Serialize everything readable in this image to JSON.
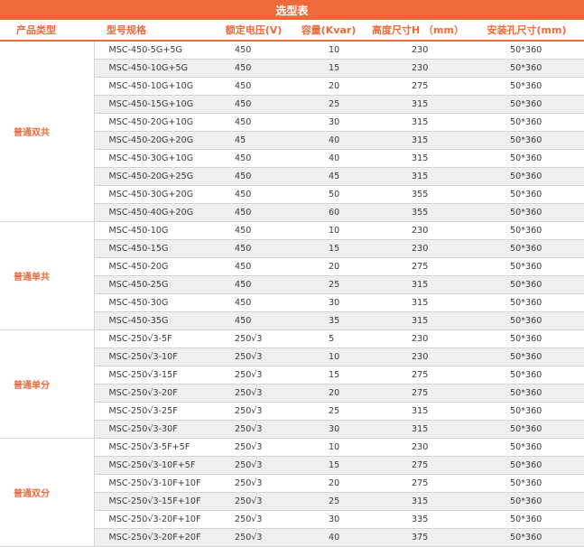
{
  "title": "选型表",
  "headers": [
    "产品类型",
    "型号规格",
    "额定电压(V)",
    "容量(Kvar)",
    "高度尺寸H （mm）",
    "安装孔尺寸(mm)"
  ],
  "groups": [
    {
      "type": "普通双共",
      "rows": [
        [
          "MSC-450-5G+5G",
          "450",
          "10",
          "230",
          "50*360"
        ],
        [
          "MSC-450-10G+5G",
          "450",
          "15",
          "230",
          "50*360"
        ],
        [
          "MSC-450-10G+10G",
          "450",
          "20",
          "275",
          "50*360"
        ],
        [
          "MSC-450-15G+10G",
          "450",
          "25",
          "315",
          "50*360"
        ],
        [
          "MSC-450-20G+10G",
          "450",
          "30",
          "315",
          "50*360"
        ],
        [
          "MSC-450-20G+20G",
          "45",
          "40",
          "315",
          "50*360"
        ],
        [
          "MSC-450-30G+10G",
          "450",
          "40",
          "315",
          "50*360"
        ],
        [
          "MSC-450-20G+25G",
          "450",
          "45",
          "315",
          "50*360"
        ],
        [
          "MSC-450-30G+20G",
          "450",
          "50",
          "355",
          "50*360"
        ],
        [
          "MSC-450-40G+20G",
          "450",
          "60",
          "355",
          "50*360"
        ]
      ]
    },
    {
      "type": "普通单共",
      "rows": [
        [
          "MSC-450-10G",
          "450",
          "10",
          "230",
          "50*360"
        ],
        [
          "MSC-450-15G",
          "450",
          "15",
          "230",
          "50*360"
        ],
        [
          "MSC-450-20G",
          "450",
          "20",
          "275",
          "50*360"
        ],
        [
          "MSC-450-25G",
          "450",
          "25",
          "315",
          "50*360"
        ],
        [
          "MSC-450-30G",
          "450",
          "30",
          "315",
          "50*360"
        ],
        [
          "MSC-450-35G",
          "450",
          "35",
          "315",
          "50*360"
        ]
      ]
    },
    {
      "type": "普通单分",
      "rows": [
        [
          "MSC-250√3-5F",
          "250√3",
          "5",
          "230",
          "50*360"
        ],
        [
          "MSC-250√3-10F",
          "250√3",
          "10",
          "230",
          "50*360"
        ],
        [
          "MSC-250√3-15F",
          "250√3",
          "15",
          "275",
          "50*360"
        ],
        [
          "MSC-250√3-20F",
          "250√3",
          "20",
          "275",
          "50*360"
        ],
        [
          "MSC-250√3-25F",
          "250√3",
          "25",
          "315",
          "50*360"
        ],
        [
          "MSC-250√3-30F",
          "250√3",
          "30",
          "315",
          "50*360"
        ]
      ]
    },
    {
      "type": "普通双分",
      "rows": [
        [
          "MSC-250√3-5F+5F",
          "250√3",
          "10",
          "230",
          "50*360"
        ],
        [
          "MSC-250√3-10F+5F",
          "250√3",
          "15",
          "275",
          "50*360"
        ],
        [
          "MSC-250√3-10F+10F",
          "250√3",
          "20",
          "275",
          "50*360"
        ],
        [
          "MSC-250√3-15F+10F",
          "250√3",
          "25",
          "315",
          "50*360"
        ],
        [
          "MSC-250√3-20F+10F",
          "250√3",
          "30",
          "335",
          "50*360"
        ],
        [
          "MSC-250√3-20F+20F",
          "250√3",
          "40",
          "375",
          "50*360"
        ]
      ]
    }
  ],
  "colors": {
    "accent": "#ee6a3a",
    "stripe": "#efefef",
    "text": "#3a3a3a"
  }
}
